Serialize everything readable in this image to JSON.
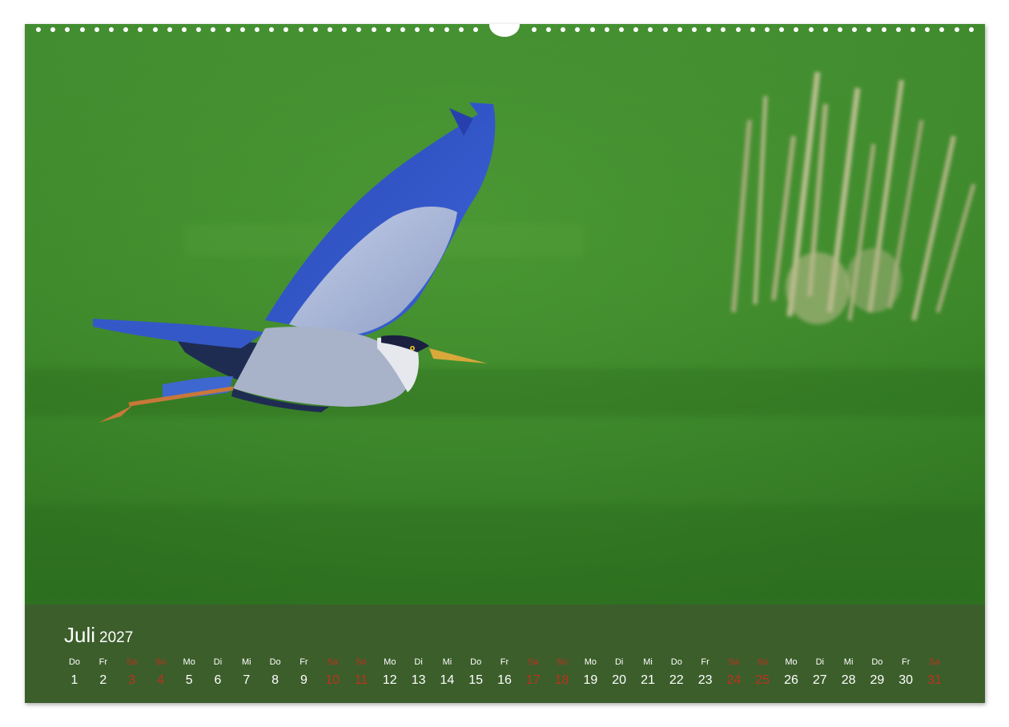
{
  "calendar": {
    "month": "Juli",
    "year": "2027",
    "days": [
      {
        "wd": "Do",
        "n": "1",
        "weekend": false
      },
      {
        "wd": "Fr",
        "n": "2",
        "weekend": false
      },
      {
        "wd": "Sa",
        "n": "3",
        "weekend": true
      },
      {
        "wd": "So",
        "n": "4",
        "weekend": true
      },
      {
        "wd": "Mo",
        "n": "5",
        "weekend": false
      },
      {
        "wd": "Di",
        "n": "6",
        "weekend": false
      },
      {
        "wd": "Mi",
        "n": "7",
        "weekend": false
      },
      {
        "wd": "Do",
        "n": "8",
        "weekend": false
      },
      {
        "wd": "Fr",
        "n": "9",
        "weekend": false
      },
      {
        "wd": "Sa",
        "n": "10",
        "weekend": true
      },
      {
        "wd": "So",
        "n": "11",
        "weekend": true
      },
      {
        "wd": "Mo",
        "n": "12",
        "weekend": false
      },
      {
        "wd": "Di",
        "n": "13",
        "weekend": false
      },
      {
        "wd": "Mi",
        "n": "14",
        "weekend": false
      },
      {
        "wd": "Do",
        "n": "15",
        "weekend": false
      },
      {
        "wd": "Fr",
        "n": "16",
        "weekend": false
      },
      {
        "wd": "Sa",
        "n": "17",
        "weekend": true
      },
      {
        "wd": "So",
        "n": "18",
        "weekend": true
      },
      {
        "wd": "Mo",
        "n": "19",
        "weekend": false
      },
      {
        "wd": "Di",
        "n": "20",
        "weekend": false
      },
      {
        "wd": "Mi",
        "n": "21",
        "weekend": false
      },
      {
        "wd": "Do",
        "n": "22",
        "weekend": false
      },
      {
        "wd": "Fr",
        "n": "23",
        "weekend": false
      },
      {
        "wd": "Sa",
        "n": "24",
        "weekend": true
      },
      {
        "wd": "So",
        "n": "25",
        "weekend": true
      },
      {
        "wd": "Mo",
        "n": "26",
        "weekend": false
      },
      {
        "wd": "Di",
        "n": "27",
        "weekend": false
      },
      {
        "wd": "Mi",
        "n": "28",
        "weekend": false
      },
      {
        "wd": "Do",
        "n": "29",
        "weekend": false
      },
      {
        "wd": "Fr",
        "n": "30",
        "weekend": false
      },
      {
        "wd": "Sa",
        "n": "31",
        "weekend": true
      }
    ]
  },
  "colors": {
    "band": "#3c5e2b",
    "weekend": "#c0301e",
    "text": "#ffffff"
  }
}
